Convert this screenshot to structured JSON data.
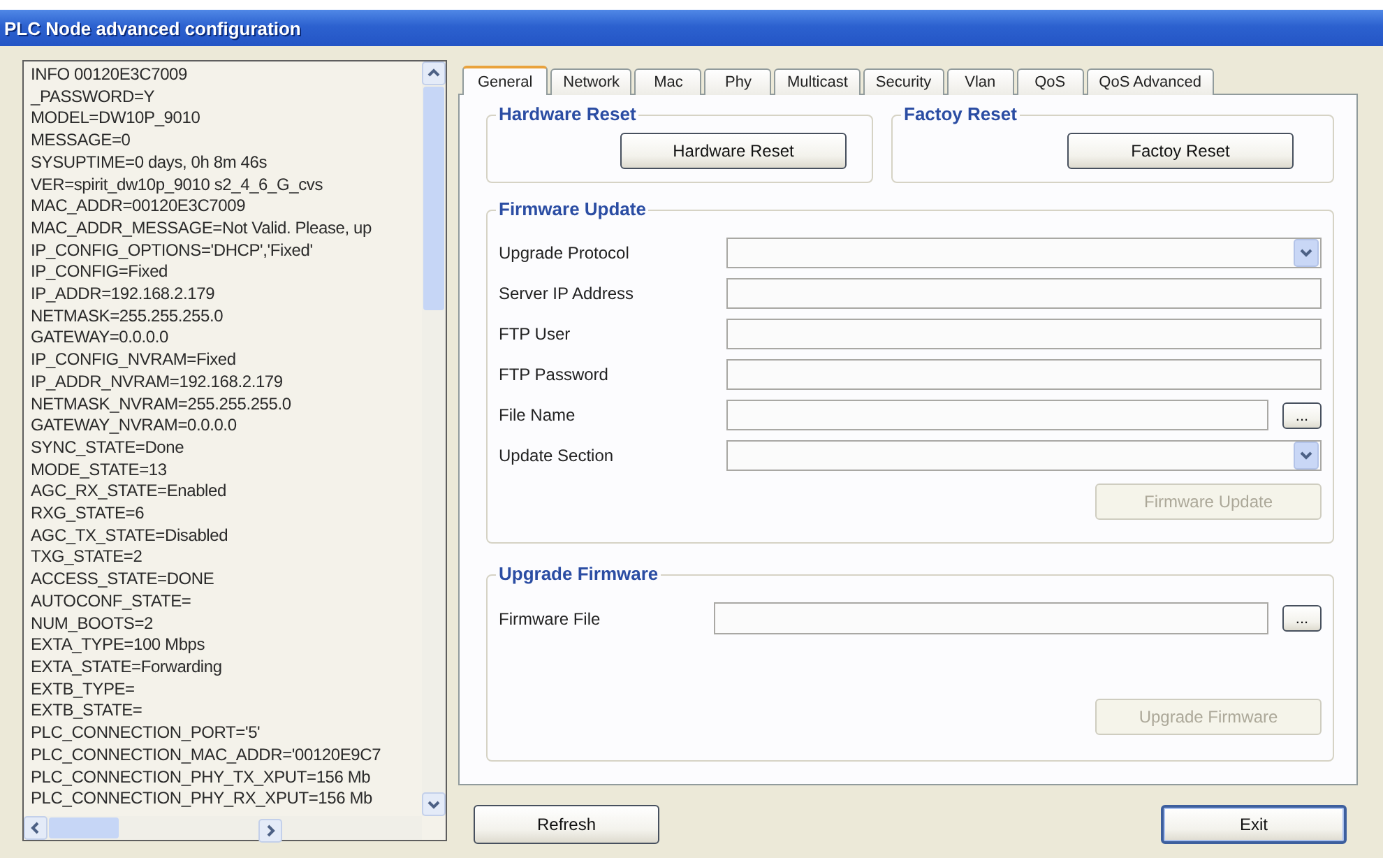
{
  "window": {
    "title": "PLC Node advanced configuration"
  },
  "info_list": {
    "lines": [
      "INFO 00120E3C7009",
      "_PASSWORD=Y",
      "MODEL=DW10P_9010",
      "MESSAGE=0",
      "SYSUPTIME=0 days, 0h 8m 46s",
      "VER=spirit_dw10p_9010 s2_4_6_G_cvs",
      "MAC_ADDR=00120E3C7009",
      "MAC_ADDR_MESSAGE=Not Valid. Please, up",
      "IP_CONFIG_OPTIONS='DHCP','Fixed'",
      "IP_CONFIG=Fixed",
      "IP_ADDR=192.168.2.179",
      "NETMASK=255.255.255.0",
      "GATEWAY=0.0.0.0",
      "IP_CONFIG_NVRAM=Fixed",
      "IP_ADDR_NVRAM=192.168.2.179",
      "NETMASK_NVRAM=255.255.255.0",
      "GATEWAY_NVRAM=0.0.0.0",
      "SYNC_STATE=Done",
      "MODE_STATE=13",
      "AGC_RX_STATE=Enabled",
      "RXG_STATE=6",
      "AGC_TX_STATE=Disabled",
      "TXG_STATE=2",
      "ACCESS_STATE=DONE",
      "AUTOCONF_STATE=",
      "NUM_BOOTS=2",
      "EXTA_TYPE=100 Mbps",
      "EXTA_STATE=Forwarding",
      "EXTB_TYPE=",
      "EXTB_STATE=",
      "PLC_CONNECTION_PORT='5'",
      "PLC_CONNECTION_MAC_ADDR='00120E9C7",
      "PLC_CONNECTION_PHY_TX_XPUT=156 Mb",
      "PLC_CONNECTION_PHY_RX_XPUT=156 Mb"
    ]
  },
  "tabs": [
    {
      "label": "General",
      "selected": true
    },
    {
      "label": "Network",
      "selected": false
    },
    {
      "label": "Mac",
      "selected": false
    },
    {
      "label": "Phy",
      "selected": false
    },
    {
      "label": "Multicast",
      "selected": false
    },
    {
      "label": "Security",
      "selected": false
    },
    {
      "label": "Vlan",
      "selected": false
    },
    {
      "label": "QoS",
      "selected": false
    },
    {
      "label": "QoS Advanced",
      "selected": false
    }
  ],
  "hardware_reset": {
    "title": "Hardware Reset",
    "button": {
      "label": "Hardware Reset",
      "disabled": false
    }
  },
  "factory_reset": {
    "title": "Factoy Reset",
    "button": {
      "label": "Factoy Reset",
      "disabled": false
    }
  },
  "firmware_update": {
    "title": "Firmware Update",
    "fields": [
      {
        "label": "Upgrade Protocol",
        "kind": "select"
      },
      {
        "label": "Server IP Address",
        "kind": "text"
      },
      {
        "label": "FTP User",
        "kind": "text"
      },
      {
        "label": "FTP Password",
        "kind": "text"
      },
      {
        "label": "File Name",
        "kind": "file",
        "browse_label": "..."
      },
      {
        "label": "Update Section",
        "kind": "select"
      }
    ],
    "button": {
      "label": "Firmware Update",
      "disabled": true
    }
  },
  "upgrade_firmware": {
    "title": "Upgrade Firmware",
    "fields": [
      {
        "label": "Firmware File",
        "kind": "file",
        "browse_label": "..."
      }
    ],
    "button": {
      "label": "Upgrade Firmware",
      "disabled": true
    }
  },
  "footer_buttons": [
    {
      "label": "Refresh",
      "default": false
    },
    {
      "label": "Exit",
      "default": true
    }
  ]
}
